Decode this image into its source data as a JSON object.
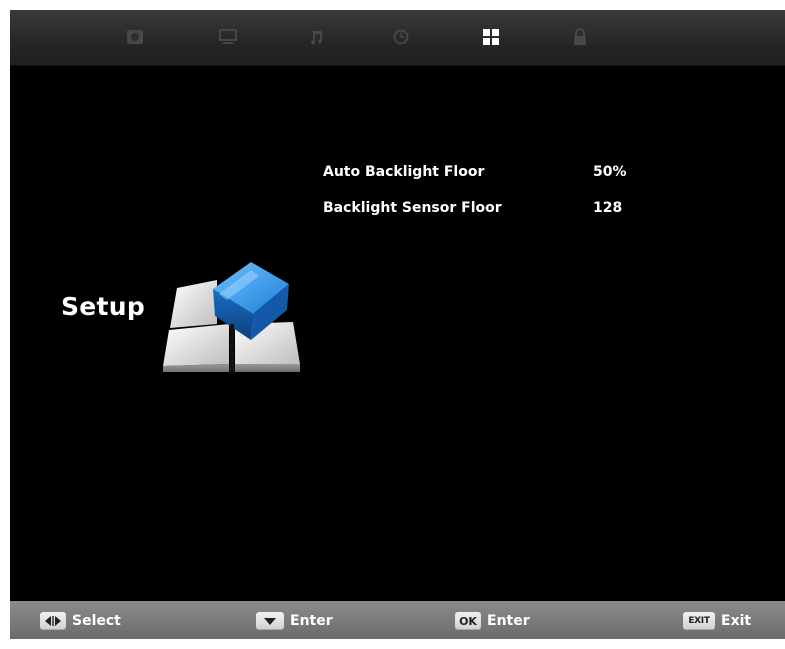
{
  "topbar": {
    "tabs": [
      {
        "icon": "picture-icon",
        "active": false
      },
      {
        "icon": "screen-icon",
        "active": false
      },
      {
        "icon": "music-note-icon",
        "active": false
      },
      {
        "icon": "clock-icon",
        "active": false
      },
      {
        "icon": "grid-icon",
        "active": true
      },
      {
        "icon": "lock-icon",
        "active": false
      }
    ],
    "active_color": "#ffffff",
    "inactive_color": "#4a4a4a"
  },
  "menu": {
    "title": "Setup",
    "settings": [
      {
        "label": "Auto Backlight Floor",
        "value": "50%"
      },
      {
        "label": "Backlight Sensor Floor",
        "value": "128"
      }
    ]
  },
  "hints": {
    "select_label": "Select",
    "down_label": "Enter",
    "ok_key": "OK",
    "ok_label": "Enter",
    "exit_key": "EXIT",
    "exit_label": "Exit"
  }
}
